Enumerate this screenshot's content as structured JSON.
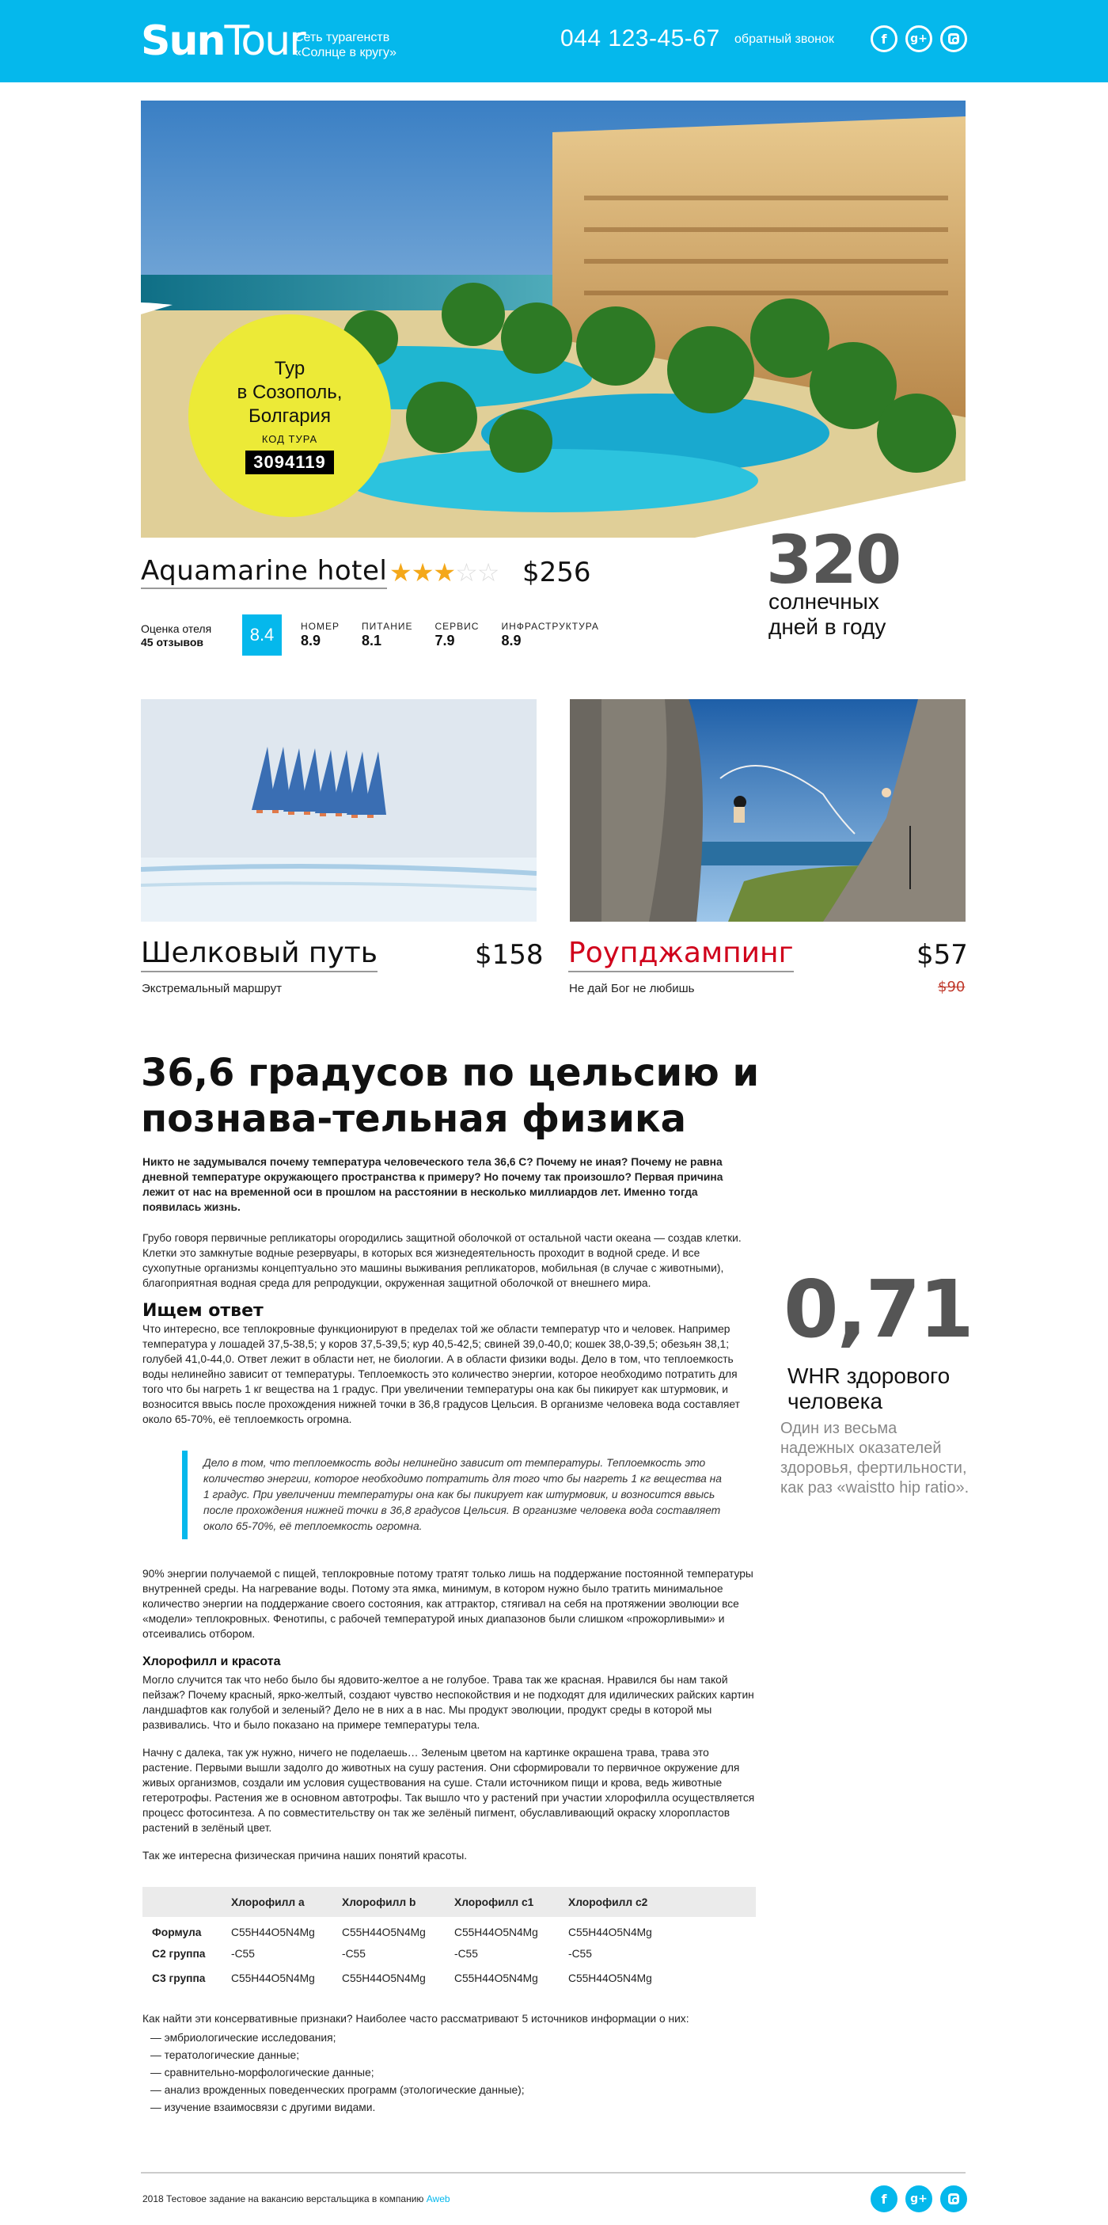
{
  "header": {
    "logo_bold": "Sun",
    "logo_light": "Tour",
    "tagline_line1": "Сеть турагенств",
    "tagline_line2": "«Солнце в кругу»",
    "phone": "044 123-45-67",
    "callback": "обратный звонок",
    "socials": {
      "facebook": "f",
      "google": "g+",
      "instagram": ""
    }
  },
  "colors": {
    "accent": "#05b8ec",
    "badge": "#ecea37",
    "star": "#f4a81a",
    "red": "#d0021b"
  },
  "hero": {
    "badge_title_1": "Тур",
    "badge_title_2": "в Созополь,",
    "badge_title_3": "Болгария",
    "code_label": "КОД ТУРА",
    "code": "3094119"
  },
  "hotel": {
    "name": "Aquamarine hotel",
    "stars_rating": 3,
    "stars_max": 5,
    "price": "$256",
    "rating_label": "Оценка отеля",
    "reviews": "45 отзывов",
    "rating": "8.4",
    "scores": [
      {
        "label": "НОМЕР",
        "value": "8.9"
      },
      {
        "label": "ПИТАНИЕ",
        "value": "8.1"
      },
      {
        "label": "СЕРВИС",
        "value": "7.9"
      },
      {
        "label": "ИНФРАСТРУКТУРА",
        "value": "8.9"
      }
    ]
  },
  "sunny": {
    "number": "320",
    "label_1": "солнечных",
    "label_2": "дней в году"
  },
  "tours": [
    {
      "name": "Шелковый путь",
      "price": "$158",
      "subtitle": "Экстремальный маршрут"
    },
    {
      "name": "Роупджампинг",
      "price": "$57",
      "old_price": "$90",
      "subtitle": "Не дай Бог не любишь"
    }
  ],
  "article": {
    "title": "36,6 градусов по цельсию и познава-тельная физика",
    "lead": "Никто не задумывался почему температура человеческого тела 36,6 С? Почему не иная? Почему не равна дневной температуре окружающего пространства к примеру? Но почему так произошло? Первая причина лежит от нас на временной оси в прошлом на расстоянии в несколько миллиардов лет. Именно тогда появилась жизнь.",
    "p1": "Грубо говоря первичные репликаторы огородились защитной оболочкой от остальной части океана — создав клетки. Клетки это замкнутые водные резервуары, в которых вся жизнедеятельность проходит в водной среде. И все сухопутные организмы концептуально это машины выживания репликаторов, мобильная (в случае с животными), благоприятная водная среда для репродукции, окруженная защитной оболочкой от внешнего мира.",
    "h_answer": "Ищем ответ",
    "p2": "Что интересно, все теплокровные функционируют в пределах той же области температур что и человек. Например температура у лошадей 37,5-38,5; у коров 37,5-39,5; кур 40,5-42,5; свиней 39,0-40,0; кошек 38,0-39,5; обезьян 38,1; голубей 41,0-44,0. Ответ лежит в области нет, не биологии. А в области физики воды. Дело в том, что теплоемкость воды нелинейно зависит от температуры. Теплоемкость это количество энергии, которое необходимо потратить для того что бы нагреть 1 кг вещества на 1 градус. При увеличении температуры она как бы пикирует как штурмовик, и возносится ввысь после прохождения нижней точки в 36,8 градусов Цельсия. В организме человека вода составляет около 65-70%, её теплоемкость огромна.",
    "quote": "Дело в том, что теплоемкость воды нелинейно зависит от температуры. Теплоемкость это количество энергии, которое необходимо потратить для того что бы нагреть 1 кг вещества на 1 градус. При увеличении температуры она как бы пикирует как штурмовик, и возносится ввысь после прохождения нижней точки    в 36,8 градусов Цельсия. В организме человека вода составляет около 65-70%, её теплоемкость огромна.",
    "p3": "90% энергии получаемой с пищей, теплокровные потому тратят только лишь на поддержание постоянной температуры внутренней среды. На нагревание воды. Потому эта ямка, минимум, в котором нужно было тратить минимальное количество энергии на поддержание своего состояния, как аттрактор, стягивал на себя на протяжении эволюции все «модели» теплокровных. Фенотипы, с рабочей температурой иных диапазонов были слишком «прожорливыми» и отсеивались отбором.",
    "h_chloro": "Хлорофилл и красота",
    "p4": "Могло случится так что небо было бы ядовито-желтое а не голубое. Трава так же красная. Нравился бы нам такой пейзаж? Почему красный, ярко-желтый, создают чувство неспокойствия и не подходят для идилических райских картин ландшафтов как голубой и зеленый? Дело не в них а в нас. Мы продукт эволюции, продукт среды в которой мы развивались. Что и было показано на примере температуры тела.",
    "p5": "Начну с далека, так уж нужно, ничего не поделаешь… Зеленым цветом на картинке окрашена трава, трава это растение. Первыми вышли задолго до животных на сушу растения. Они сформировали то первичное окружение для живых организмов, создали им условия существования на суше. Стали источником пищи и крова, ведь животные гетеротрофы. Растения же в основном автотрофы. Так вышло что у растений при участии хлорофилла осуществляется процесс фотосинтеза. А по совместительству он так же зелёный пигмент, обуславливающий окраску хлоропластов растений в зелёный цвет.",
    "p6": "Так же интересна физическая причина наших понятий красоты.",
    "table": {
      "headers": [
        "",
        "Хлорофилл a",
        "Хлорофилл b",
        "Хлорофилл c1",
        "Хлорофилл c2"
      ],
      "rows": [
        {
          "label": "Формула",
          "cells": [
            "C55H44O5N4Mg",
            "C55H44O5N4Mg",
            "C55H44O5N4Mg",
            "C55H44O5N4Mg"
          ]
        },
        {
          "label": "C2 группа",
          "cells": [
            "-C55",
            "-C55",
            "-C55",
            "-C55"
          ]
        },
        {
          "label": "C3 группа",
          "cells": [
            "C55H44O5N4Mg",
            "C55H44O5N4Mg",
            "C55H44O5N4Mg",
            "C55H44O5N4Mg"
          ]
        }
      ]
    },
    "p7": "Как найти эти консервативные признаки? Наиболее часто рассматривают 5 источников информации о них:",
    "list": [
      "— эмбриологические исследования;",
      "— тератологические данные;",
      "— сравнительно-морфологические данные;",
      "— анализ врожденных поведенческих программ (этологические данные);",
      "— изучение взаимосвязи с другими видами."
    ]
  },
  "whr": {
    "number": "0,71",
    "label": "WHR здорового человека",
    "description": "Один из весьма надежных оказателей здоровья, фертильности, как раз «waistto hip ratio»."
  },
  "footer": {
    "text": "2018 Тестовое задание на вакансию верстальщика в компанию",
    "link": "Aweb"
  }
}
